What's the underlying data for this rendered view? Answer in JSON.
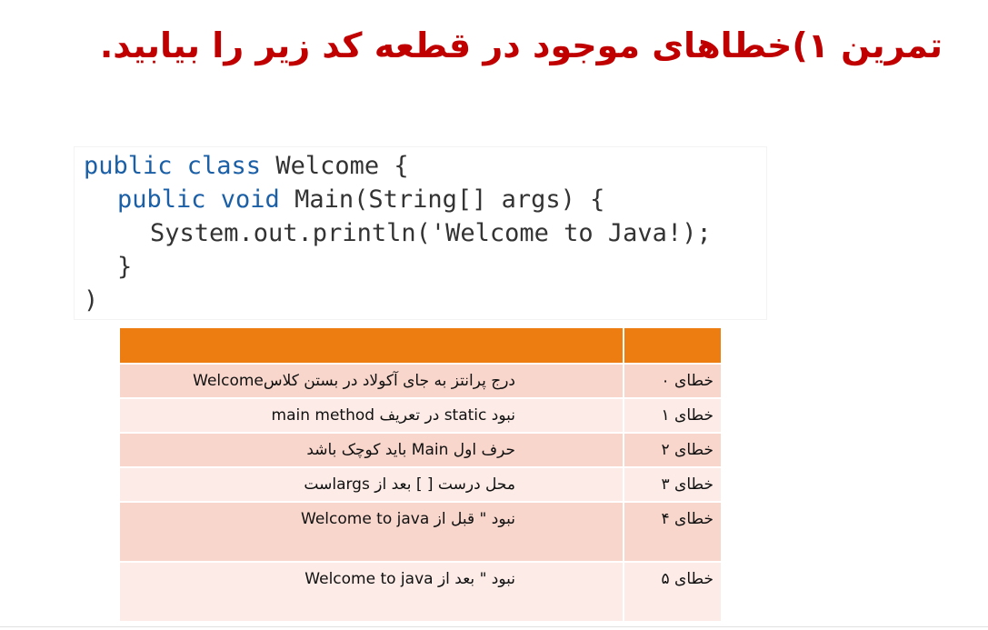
{
  "title": "تمرین ۱)خطاهای موجود در قطعه کد زیر را بیابید.",
  "code": {
    "lines": [
      {
        "kw": "public class ",
        "rest": "Welcome {"
      },
      {
        "kw": "public void ",
        "rest": "Main(String[] args) {"
      },
      {
        "kw": "",
        "rest": "System.out.println('Welcome to Java!);"
      },
      {
        "kw": "",
        "rest": "}"
      },
      {
        "kw": "",
        "rest": ")"
      }
    ]
  },
  "table": {
    "header": [
      "",
      ""
    ],
    "rows": [
      {
        "label": "خطای ۰",
        "description": "درج پرانتز به جای آکولاد در بستن کلاسWelcome"
      },
      {
        "label": "خطای ۱",
        "description": "نبود static در تعریف main method"
      },
      {
        "label": "خطای ۲",
        "description": "حرف اول Main باید کوچک باشد"
      },
      {
        "label": "خطای ۳",
        "description": "محل درست [ ] بعد از argsاست"
      },
      {
        "label": "خطای ۴",
        "description": "نبود \" قبل از Welcome to java"
      },
      {
        "label": "خطای ۵",
        "description": "نبود \" بعد از Welcome to java"
      }
    ]
  }
}
